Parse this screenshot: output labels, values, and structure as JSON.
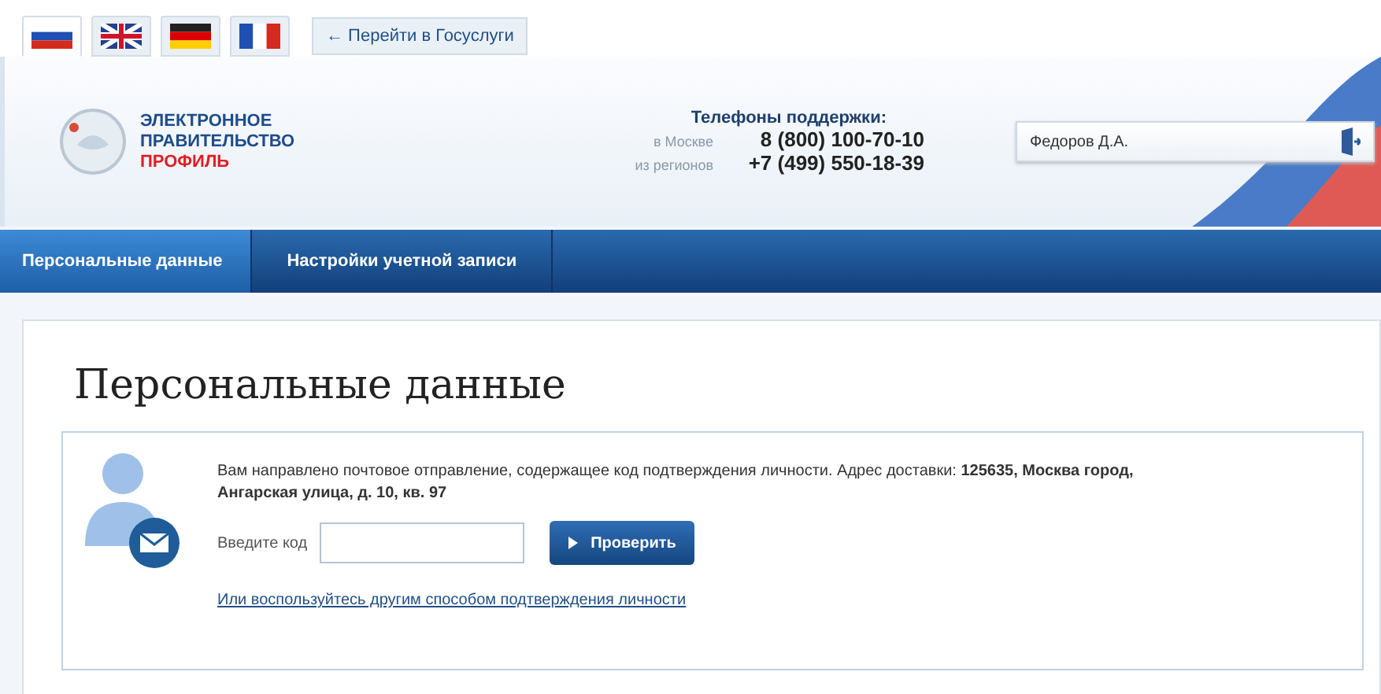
{
  "languages": [
    {
      "kind": "russia",
      "selected": true
    },
    {
      "kind": "britain",
      "selected": false
    },
    {
      "kind": "germany",
      "selected": false
    },
    {
      "kind": "france",
      "selected": false
    }
  ],
  "gosuslugi_link": "← Перейти в Госуслуги",
  "logo": {
    "line1": "ЭЛЕКТРОННОЕ",
    "line2": "ПРАВИТЕЛЬСТВО",
    "line3": "ПРОФИЛЬ"
  },
  "support": {
    "title": "Телефоны поддержки:",
    "phones": [
      {
        "label": "в Москве",
        "number": "8 (800) 100-70-10"
      },
      {
        "label": "из регионов",
        "number": "+7 (499) 550-18-39"
      }
    ]
  },
  "user": {
    "name": "Федоров Д.А."
  },
  "tabs": [
    {
      "label": "Персональные данные",
      "selected": true
    },
    {
      "label": "Настройки учетной записи",
      "selected": false
    }
  ],
  "page_title": "Персональные данные",
  "notice": {
    "text": "Вам направлено почтовое отправление, содержащее код подтверждения личности. Адрес доставки: **125635, Москва город, Ангарская улица, д. 10, кв. 97**",
    "code_label": "Введите код",
    "verify_button": "Проверить",
    "alt_link": "Или воспользуйтесь другим способом подтверждения личности"
  }
}
